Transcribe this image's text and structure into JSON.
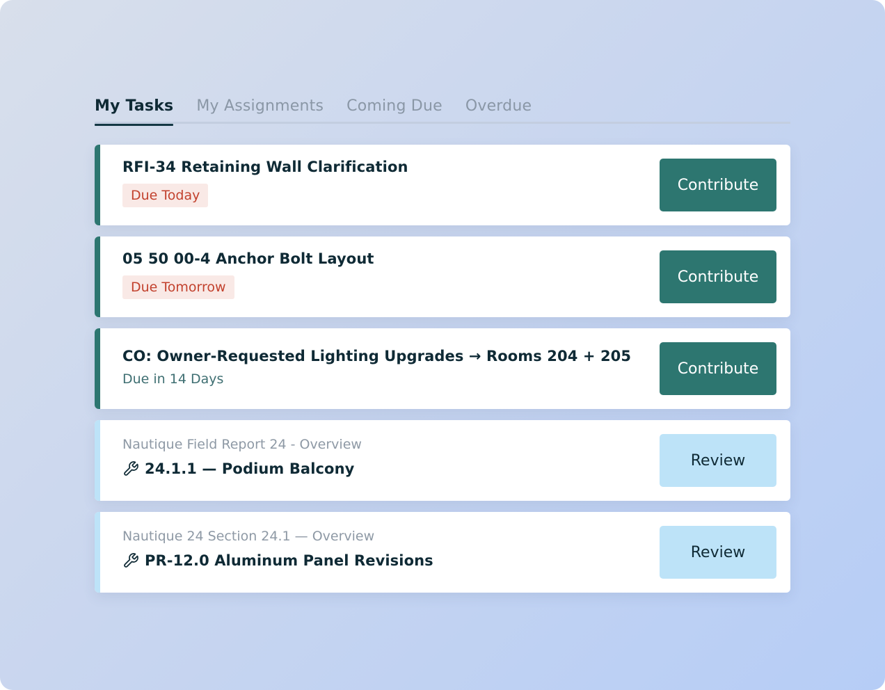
{
  "tabs": [
    {
      "label": "My Tasks",
      "active": true
    },
    {
      "label": "My Assignments",
      "active": false
    },
    {
      "label": "Coming Due",
      "active": false
    },
    {
      "label": "Overdue",
      "active": false
    }
  ],
  "tasks": [
    {
      "title": "RFI-34 Retaining Wall Clarification",
      "due": "Due Today",
      "button": "Contribute"
    },
    {
      "title": "05 50 00-4 Anchor Bolt Layout",
      "due": "Due Tomorrow",
      "button": "Contribute"
    },
    {
      "title": "CO: Owner-Requested Lighting Upgrades → Rooms 204 + 205",
      "due": "Due in 14 Days",
      "button": "Contribute"
    },
    {
      "subtitle": "Nautique Field Report 24 - Overview",
      "item_icon": "wrench-icon",
      "title": "24.1.1 — Podium Balcony",
      "button": "Review"
    },
    {
      "subtitle": "Nautique 24 Section 24.1 — Overview",
      "item_icon": "wrench-icon",
      "title": "PR-12.0 Aluminum Panel Revisions",
      "button": "Review"
    }
  ],
  "colors": {
    "accent_teal": "#2d7670",
    "accent_light_blue": "#bde3f8",
    "due_urgent_text": "#c2412d",
    "due_urgent_bg": "#f9e9e6",
    "title_text": "#0f2a35"
  }
}
